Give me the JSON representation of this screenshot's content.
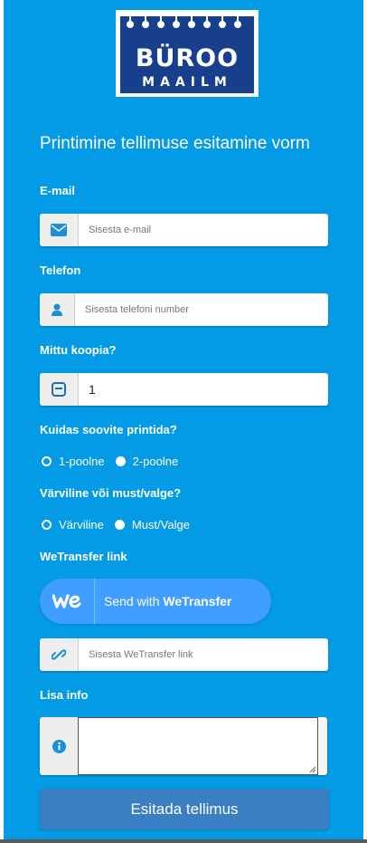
{
  "brand": {
    "name": "BÜROO",
    "subtitle": "MAAILM"
  },
  "form": {
    "title": "Printimine tellimuse esitamine vorm",
    "email": {
      "label": "E-mail",
      "placeholder": "Sisesta e-mail",
      "icon": "envelope-icon"
    },
    "phone": {
      "label": "Telefon",
      "placeholder": "Sisesta telefoni number",
      "icon": "user-icon"
    },
    "copies": {
      "label": "Mittu koopia?",
      "value": "1",
      "icon": "square-icon"
    },
    "print_side": {
      "label": "Kuidas soovite printida?",
      "options": [
        "1-poolne",
        "2-poolne"
      ],
      "selected": "2-poolne"
    },
    "color_mode": {
      "label": "Värviline või must/valge?",
      "options": [
        "Värviline",
        "Must/Valge"
      ],
      "selected": "Must/Valge"
    },
    "wetransfer": {
      "label": "WeTransfer link",
      "button_prefix": "Send with",
      "button_brand": "WeTransfer",
      "link_placeholder": "Sisesta WeTransfer link",
      "icon": "link-icon"
    },
    "extra_info": {
      "label": "Lisa info",
      "icon": "info-icon"
    },
    "submit_label": "Esitada tellimus"
  },
  "colors": {
    "panel": "#039be5",
    "wetransfer": "#409eff",
    "submit": "#3a7fc1",
    "logo": "#173f8c"
  }
}
